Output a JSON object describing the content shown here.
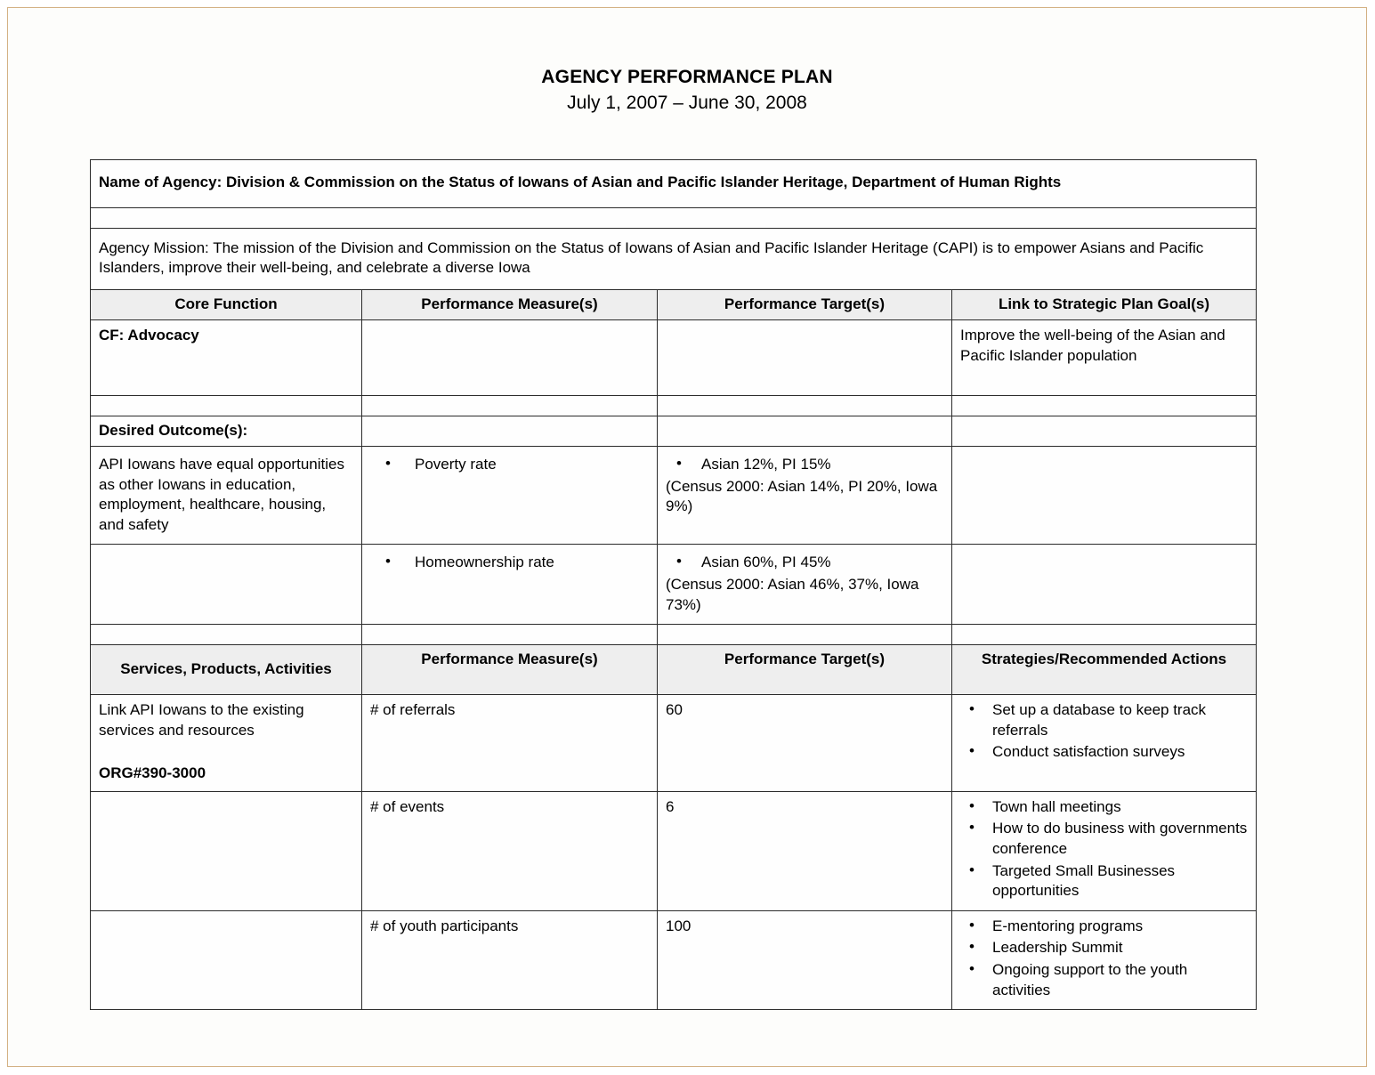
{
  "document": {
    "title": "AGENCY PERFORMANCE PLAN",
    "period": "July 1, 2007 – June 30, 2008"
  },
  "agency": {
    "name_row": "Name of Agency: Division & Commission on the Status of Iowans of Asian and Pacific Islander Heritage, Department of Human Rights",
    "mission_row": "Agency Mission: The mission of the Division and Commission on the Status of Iowans of Asian and Pacific Islander Heritage (CAPI) is to empower Asians and Pacific Islanders, improve their well-being, and celebrate a diverse Iowa"
  },
  "table_one": {
    "headers": [
      "Core Function",
      "Performance Measure(s)",
      "Performance Target(s)",
      "Link to Strategic Plan Goal(s)"
    ],
    "core_function_label": "CF: Advocacy",
    "strategic_goal": "Improve the well-being of the Asian and Pacific Islander population",
    "desired_outcome_label": "Desired Outcome(s):",
    "rows": [
      {
        "outcome": "API Iowans have equal opportunities as other Iowans in education, employment, healthcare,  housing, and safety",
        "measure": "Poverty rate",
        "target_bullet": "Asian 12%, PI 15%",
        "target_note": "(Census 2000: Asian 14%, PI 20%, Iowa 9%)",
        "goal": ""
      },
      {
        "outcome": "",
        "measure": "Homeownership rate",
        "target_bullet": "Asian 60%, PI 45%",
        "target_note": "(Census 2000: Asian 46%, 37%, Iowa 73%)",
        "goal": ""
      }
    ]
  },
  "table_two": {
    "headers": [
      "Services, Products, Activities",
      "Performance Measure(s)",
      "Performance Target(s)",
      "Strategies/Recommended Actions"
    ],
    "activity": "Link API Iowans to the existing services and resources",
    "org_code": "ORG#390-3000",
    "rows": [
      {
        "measure": "# of referrals",
        "target": "60",
        "strategies": [
          "Set up a database to keep track referrals",
          "Conduct satisfaction surveys"
        ]
      },
      {
        "measure": "# of events",
        "target": "6",
        "strategies": [
          "Town hall meetings",
          "How to do business with governments conference",
          "Targeted Small Businesses opportunities"
        ]
      },
      {
        "measure": "# of youth participants",
        "target": "100",
        "strategies": [
          "E-mentoring programs",
          "Leadership Summit",
          "Ongoing support to the youth activities"
        ]
      }
    ]
  }
}
